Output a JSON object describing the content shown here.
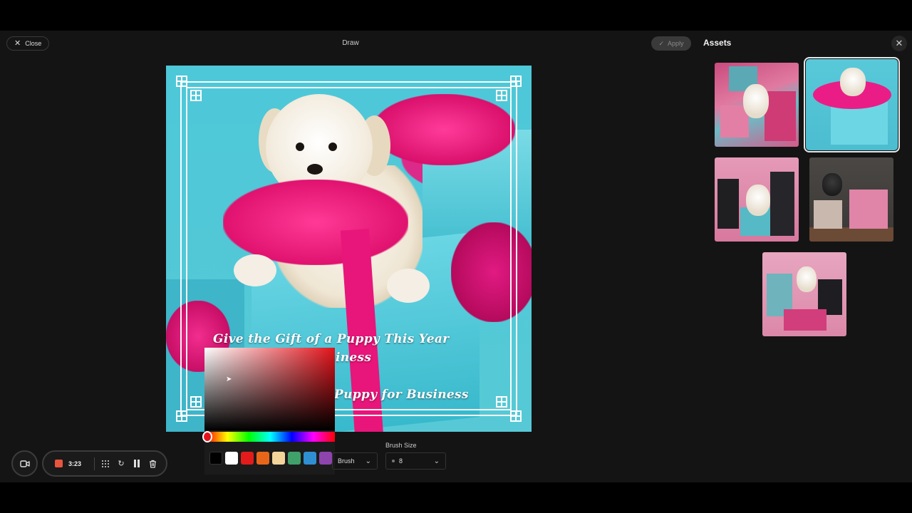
{
  "editor": {
    "close_label": "Close",
    "title": "Draw",
    "apply_label": "Apply"
  },
  "canvas": {
    "text_line1": "Give the Gift of a Puppy This Year",
    "text_line2": "iness",
    "text_line3": "Puppy for Business"
  },
  "color_picker": {
    "selected_color": "#e3131b",
    "swatches": [
      "#000000",
      "#ffffff",
      "#e31b1b",
      "#e8661a",
      "#f3d49a",
      "#3fa06a",
      "#2f8fd1",
      "#8e44ad"
    ]
  },
  "brush": {
    "type_value": "Brush",
    "size_label": "Brush Size",
    "size_value": "8"
  },
  "recording": {
    "time": "3:23"
  },
  "assets": {
    "title": "Assets",
    "thumbnails": [
      {
        "name": "asset-thumbnail-1",
        "selected": false
      },
      {
        "name": "asset-thumbnail-2",
        "selected": true
      },
      {
        "name": "asset-thumbnail-3",
        "selected": false
      },
      {
        "name": "asset-thumbnail-4",
        "selected": false
      },
      {
        "name": "asset-thumbnail-5",
        "selected": false
      }
    ]
  }
}
